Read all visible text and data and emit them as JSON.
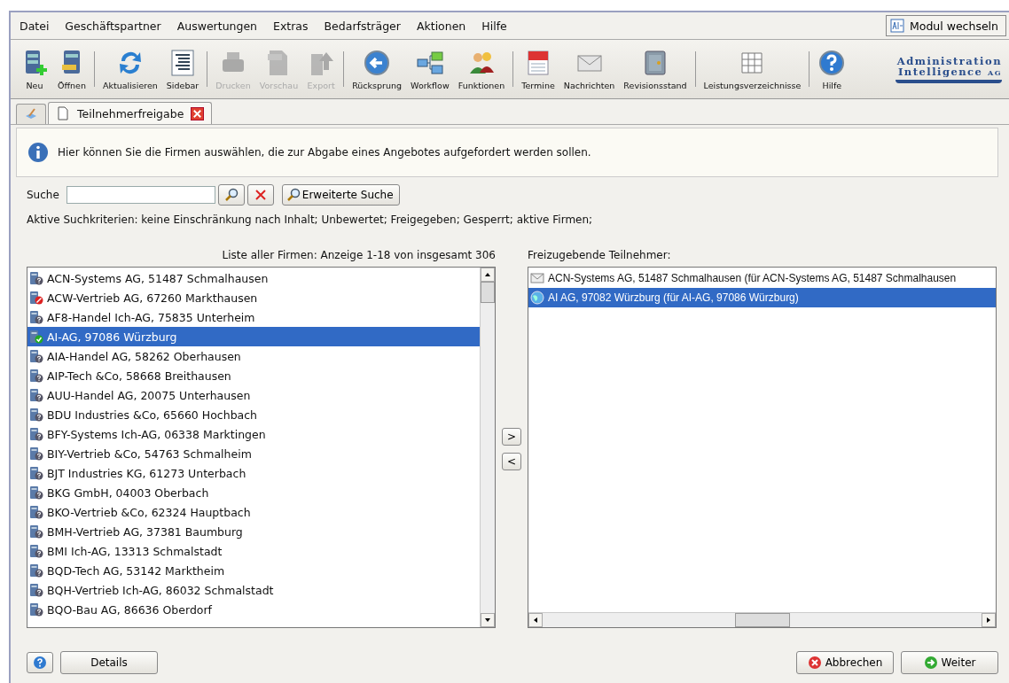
{
  "menu": [
    "Datei",
    "Geschäftspartner",
    "Auswertungen",
    "Extras",
    "Bedarfsträger",
    "Aktionen",
    "Hilfe"
  ],
  "module_button": "Modul wechseln",
  "toolbar_groups": [
    [
      {
        "label": "Neu",
        "disabled": false
      },
      {
        "label": "Öffnen",
        "disabled": false
      }
    ],
    [
      {
        "label": "Aktualisieren",
        "disabled": false
      },
      {
        "label": "Sidebar",
        "disabled": false
      }
    ],
    [
      {
        "label": "Drucken",
        "disabled": true
      },
      {
        "label": "Vorschau",
        "disabled": true
      },
      {
        "label": "Export",
        "disabled": true
      }
    ],
    [
      {
        "label": "Rücksprung",
        "disabled": false
      },
      {
        "label": "Workflow",
        "disabled": false
      },
      {
        "label": "Funktionen",
        "disabled": false
      }
    ],
    [
      {
        "label": "Termine",
        "disabled": false
      },
      {
        "label": "Nachrichten",
        "disabled": false
      },
      {
        "label": "Revisionsstand",
        "disabled": false
      }
    ],
    [
      {
        "label": "Leistungsverzeichnisse",
        "disabled": false
      }
    ],
    [
      {
        "label": "Hilfe",
        "disabled": false
      }
    ]
  ],
  "logo": {
    "line1": "Administration",
    "line2": "Intelligence",
    "suffix": "AG"
  },
  "tabs": [
    {
      "kind": "home",
      "selected": false
    },
    {
      "kind": "document",
      "label": "Teilnehmerfreigabe",
      "selected": true
    }
  ],
  "info": "Hier können Sie die Firmen auswählen, die zur Abgabe eines Angebotes aufgefordert werden sollen.",
  "search": {
    "label": "Suche",
    "advanced_button": "Erweiterte Suche"
  },
  "criteria": "Aktive Suchkriterien: keine Einschränkung nach Inhalt; Unbewertet; Freigegeben; Gesperrt; aktive Firmen;",
  "left_list": {
    "title": "Liste aller Firmen:  Anzeige 1-18 von insgesamt 306",
    "items": [
      {
        "label": "ACN-Systems AG, 51487 Schmalhausen",
        "kind": "unrated",
        "selected": false
      },
      {
        "label": "ACW-Vertrieb AG, 67260 Markthausen",
        "kind": "blocked",
        "selected": false
      },
      {
        "label": "AF8-Handel Ich-AG, 75835 Unterheim",
        "kind": "unrated",
        "selected": false
      },
      {
        "label": "AI-AG, 97086 Würzburg",
        "kind": "approved",
        "selected": true
      },
      {
        "label": "AIA-Handel AG, 58262 Oberhausen",
        "kind": "unrated",
        "selected": false
      },
      {
        "label": "AIP-Tech &Co, 58668 Breithausen",
        "kind": "unrated",
        "selected": false
      },
      {
        "label": "AUU-Handel AG, 20075 Unterhausen",
        "kind": "unrated",
        "selected": false
      },
      {
        "label": "BDU Industries &Co, 65660 Hochbach",
        "kind": "unrated",
        "selected": false
      },
      {
        "label": "BFY-Systems Ich-AG, 06338 Marktingen",
        "kind": "unrated",
        "selected": false
      },
      {
        "label": "BIY-Vertrieb &Co, 54763 Schmalheim",
        "kind": "unrated",
        "selected": false
      },
      {
        "label": "BJT Industries KG, 61273 Unterbach",
        "kind": "unrated",
        "selected": false
      },
      {
        "label": "BKG GmbH, 04003 Oberbach",
        "kind": "unrated",
        "selected": false
      },
      {
        "label": "BKO-Vertrieb &Co, 62324 Hauptbach",
        "kind": "unrated",
        "selected": false
      },
      {
        "label": "BMH-Vertrieb AG, 37381 Baumburg",
        "kind": "unrated",
        "selected": false
      },
      {
        "label": "BMI Ich-AG, 13313 Schmalstadt",
        "kind": "unrated",
        "selected": false
      },
      {
        "label": "BQD-Tech AG, 53142 Marktheim",
        "kind": "unrated",
        "selected": false
      },
      {
        "label": "BQH-Vertrieb Ich-AG, 86032 Schmalstadt",
        "kind": "unrated",
        "selected": false
      },
      {
        "label": "BQO-Bau AG, 86636 Oberdorf",
        "kind": "unrated",
        "selected": false
      }
    ]
  },
  "move_buttons": [
    ">",
    "<"
  ],
  "right_list": {
    "title": "Freizugebende Teilnehmer:",
    "items": [
      {
        "label": "ACN-Systems AG, 51487 Schmalhausen (für ACN-Systems AG, 51487 Schmalhausen",
        "kind": "mail",
        "selected": false
      },
      {
        "label": "AI AG, 97082 Würzburg (für AI-AG, 97086 Würzburg)",
        "kind": "globe",
        "selected": true
      }
    ]
  },
  "footer": {
    "details": "Details",
    "cancel": "Abbrechen",
    "next": "Weiter"
  }
}
